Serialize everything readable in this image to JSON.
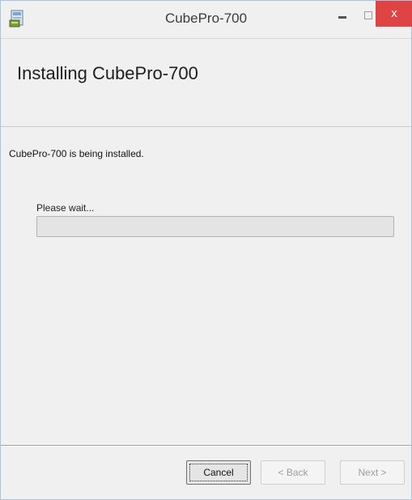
{
  "window": {
    "title": "CubePro-700",
    "icon": "installer-icon",
    "close_label": "x"
  },
  "header": {
    "title": "Installing CubePro-700"
  },
  "content": {
    "status": "CubePro-700 is being installed.",
    "wait_label": "Please wait...",
    "progress_fraction": 0
  },
  "footer": {
    "cancel_label": "Cancel",
    "back_label": "< Back",
    "next_label": "Next >"
  },
  "colors": {
    "close_button": "#e04343",
    "progress_fill": "#06b025",
    "panel_background": "#f0f0f0"
  }
}
